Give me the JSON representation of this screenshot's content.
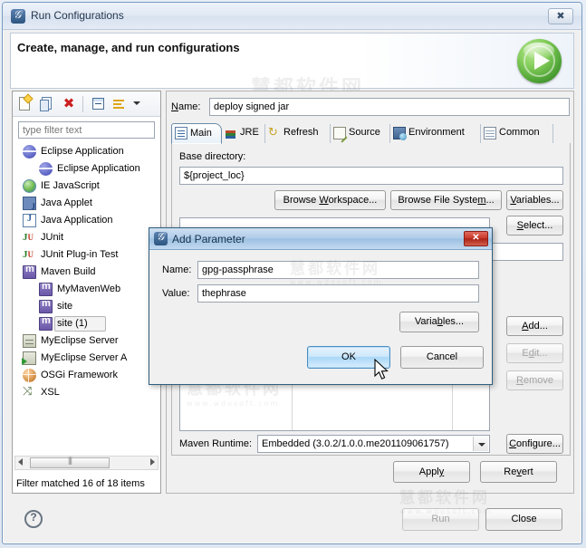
{
  "window": {
    "title": "Run Configurations",
    "icon": "eclipse-run-icon",
    "close_label": "✖"
  },
  "banner": {
    "title": "Create, manage, and run configurations",
    "run_icon": "green-run-orb-icon"
  },
  "tree_toolbar": {
    "buttons": [
      {
        "name": "new-launch-configuration-icon",
        "glyph": "new-doc"
      },
      {
        "name": "duplicate-icon",
        "glyph": "duplicate"
      },
      {
        "name": "delete-icon",
        "glyph": "red-x"
      },
      {
        "name": "collapse-all-icon",
        "glyph": "collapse"
      },
      {
        "name": "filter-icon",
        "glyph": "filter"
      },
      {
        "name": "view-menu-chevron-icon",
        "glyph": "caret-down"
      }
    ]
  },
  "filter": {
    "placeholder": "type filter text",
    "value": "",
    "status": "Filter matched 16 of 18 items"
  },
  "tree": {
    "items": [
      {
        "label": "Eclipse Application",
        "icon": "eclipse-app-icon",
        "indent": 0,
        "selected": false
      },
      {
        "label": "Eclipse Application",
        "icon": "eclipse-app-icon",
        "indent": 1,
        "selected": false
      },
      {
        "label": "IE JavaScript",
        "icon": "ie-javascript-icon",
        "indent": 0,
        "selected": false
      },
      {
        "label": "Java Applet",
        "icon": "java-applet-icon",
        "indent": 0,
        "selected": false
      },
      {
        "label": "Java Application",
        "icon": "java-application-icon",
        "indent": 0,
        "selected": false
      },
      {
        "label": "JUnit",
        "icon": "junit-icon",
        "indent": 0,
        "selected": false
      },
      {
        "label": "JUnit Plug-in Test",
        "icon": "junit-plugin-test-icon",
        "indent": 0,
        "selected": false
      },
      {
        "label": "Maven Build",
        "icon": "maven-build-icon",
        "indent": 0,
        "selected": false
      },
      {
        "label": "MyMavenWeb",
        "icon": "maven-build-icon",
        "indent": 1,
        "selected": false
      },
      {
        "label": "site",
        "icon": "maven-build-icon",
        "indent": 1,
        "selected": false
      },
      {
        "label": "site (1)",
        "icon": "maven-build-icon",
        "indent": 1,
        "selected": true
      },
      {
        "label": "MyEclipse Server",
        "icon": "myeclipse-server-icon",
        "indent": 0,
        "selected": false
      },
      {
        "label": "MyEclipse Server A",
        "icon": "myeclipse-server-app-icon",
        "indent": 0,
        "selected": false
      },
      {
        "label": "OSGi Framework",
        "icon": "osgi-framework-icon",
        "indent": 0,
        "selected": false
      },
      {
        "label": "XSL",
        "icon": "xsl-icon",
        "indent": 0,
        "selected": false
      }
    ]
  },
  "config": {
    "name_label": "Name:",
    "name_value": "deploy signed jar",
    "tabs": [
      {
        "label": "Main",
        "icon": "main-tab-icon",
        "active": true
      },
      {
        "label": "JRE",
        "icon": "jre-tab-icon",
        "active": false
      },
      {
        "label": "Refresh",
        "icon": "refresh-tab-icon",
        "active": false
      },
      {
        "label": "Source",
        "icon": "source-tab-icon",
        "active": false
      },
      {
        "label": "Environment",
        "icon": "environment-tab-icon",
        "active": false
      },
      {
        "label": "Common",
        "icon": "common-tab-icon",
        "active": false
      }
    ],
    "base_directory_label": "Base directory:",
    "base_directory_value": "${project_loc}",
    "browse_workspace_label": "Browse Workspace...",
    "browse_filesystem_label": "Browse File System...",
    "variables_label": "Variables...",
    "select_label": "Select...",
    "add_label": "Add...",
    "edit_label": "Edit...",
    "remove_label": "Remove",
    "configure_label": "Configure...",
    "maven_runtime_label": "Maven Runtime:",
    "maven_runtime_value": "Embedded (3.0.2/1.0.0.me201109061757)",
    "apply_label": "Apply",
    "revert_label": "Revert"
  },
  "dialog": {
    "title": "Add Parameter",
    "icon": "eclipse-dialog-icon",
    "close_label": "✕",
    "name_label": "Name:",
    "name_value": "gpg-passphrase",
    "value_label": "Value:",
    "value_value": "thephrase",
    "variables_label": "Variables...",
    "ok_label": "OK",
    "cancel_label": "Cancel"
  },
  "footer": {
    "help_icon": "help-question-icon",
    "run_label": "Run",
    "close_label": "Close"
  },
  "watermark": {
    "text": "慧都软件网",
    "sub": "www.wdosoft.com"
  },
  "colors": {
    "accent": "#3f6390",
    "dialog_title": "#aecbe8",
    "run_green": "#4fa336",
    "close_red": "#c8392c",
    "selection": "#f3f3f3"
  }
}
